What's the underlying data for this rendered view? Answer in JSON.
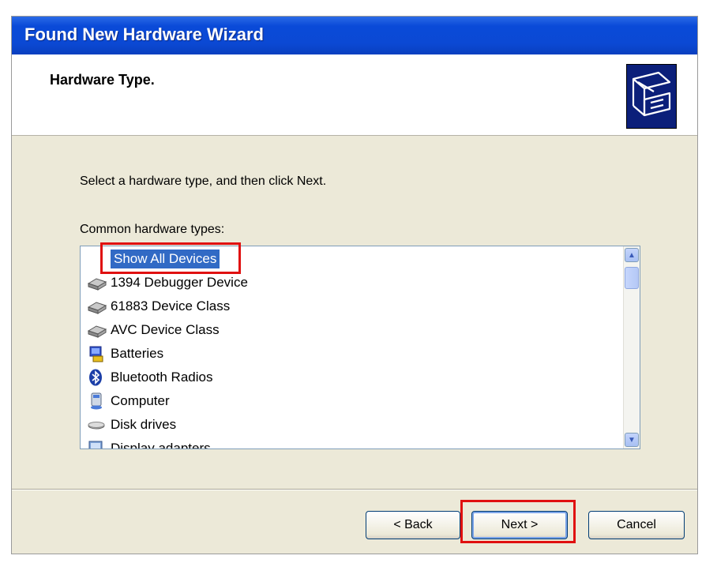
{
  "window": {
    "title": "Found New Hardware Wizard"
  },
  "header": {
    "title": "Hardware Type.",
    "icon": "hardware-card-icon"
  },
  "main": {
    "instruction": "Select a hardware type, and then click Next.",
    "list_label": "Common hardware types:",
    "selected_item": "Show All Devices",
    "items": [
      {
        "label": "Show All Devices",
        "icon": "none"
      },
      {
        "label": "1394 Debugger Device",
        "icon": "device-class-icon"
      },
      {
        "label": "61883 Device Class",
        "icon": "device-class-icon"
      },
      {
        "label": "AVC Device Class",
        "icon": "device-class-icon"
      },
      {
        "label": "Batteries",
        "icon": "battery-icon"
      },
      {
        "label": "Bluetooth Radios",
        "icon": "bluetooth-icon"
      },
      {
        "label": "Computer",
        "icon": "computer-icon"
      },
      {
        "label": "Disk drives",
        "icon": "disk-drive-icon"
      },
      {
        "label": "Display adapters",
        "icon": "display-adapter-icon"
      }
    ]
  },
  "buttons": {
    "back": "< Back",
    "next": "Next >",
    "cancel": "Cancel"
  },
  "colors": {
    "title_bar": "#0b49d4",
    "selection": "#316ac5",
    "highlight": "#e01010",
    "dialog_bg": "#ece9d8"
  }
}
